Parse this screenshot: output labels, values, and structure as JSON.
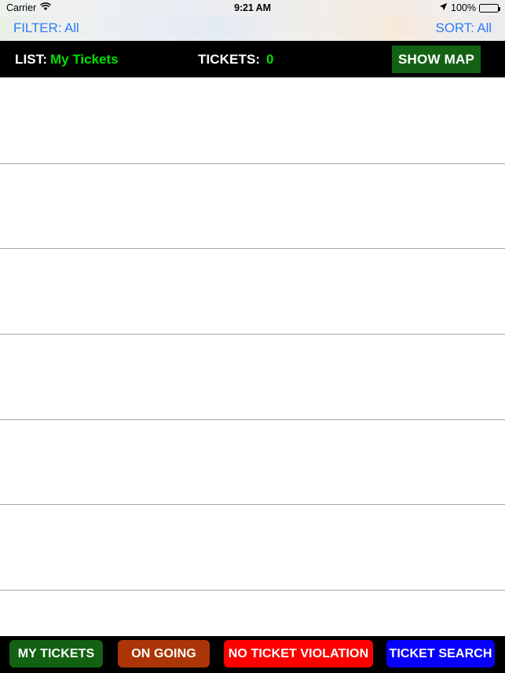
{
  "status_bar": {
    "carrier": "Carrier",
    "wifi_icon": "wifi-icon",
    "time": "9:21 AM",
    "location_icon": "location-arrow-icon",
    "battery_percent": "100%",
    "battery_icon": "battery-full-icon"
  },
  "nav_bar": {
    "filter_label": "FILTER: All",
    "sort_label": "SORT: All",
    "tint_color": "#2f7bfb"
  },
  "header": {
    "list_label": "LIST:",
    "list_value": "My Tickets",
    "tickets_label": "TICKETS:",
    "tickets_value": "0",
    "show_map_label": "SHOW MAP",
    "background": "#000000",
    "value_color": "#00e000",
    "show_map_color": "#136213"
  },
  "table": {
    "row_count": 7,
    "rows": [
      {
        "id": "row-1",
        "text": ""
      },
      {
        "id": "row-2",
        "text": ""
      },
      {
        "id": "row-3",
        "text": ""
      },
      {
        "id": "row-4",
        "text": ""
      },
      {
        "id": "row-5",
        "text": ""
      },
      {
        "id": "row-6",
        "text": ""
      },
      {
        "id": "row-7",
        "text": ""
      }
    ],
    "separator_color": "#a8a8aa",
    "background": "#ffffff"
  },
  "bottom_toolbar": {
    "background": "#000000",
    "buttons": [
      {
        "label": "MY TICKETS",
        "color": "#136213",
        "name": "my-tickets"
      },
      {
        "label": "ON GOING",
        "color": "#ab3507",
        "name": "on-going"
      },
      {
        "label": "NO TICKET VIOLATION",
        "color": "#fe0000",
        "name": "no-ticket-violation"
      },
      {
        "label": "TICKET SEARCH",
        "color": "#0700fc",
        "name": "ticket-search"
      }
    ]
  }
}
